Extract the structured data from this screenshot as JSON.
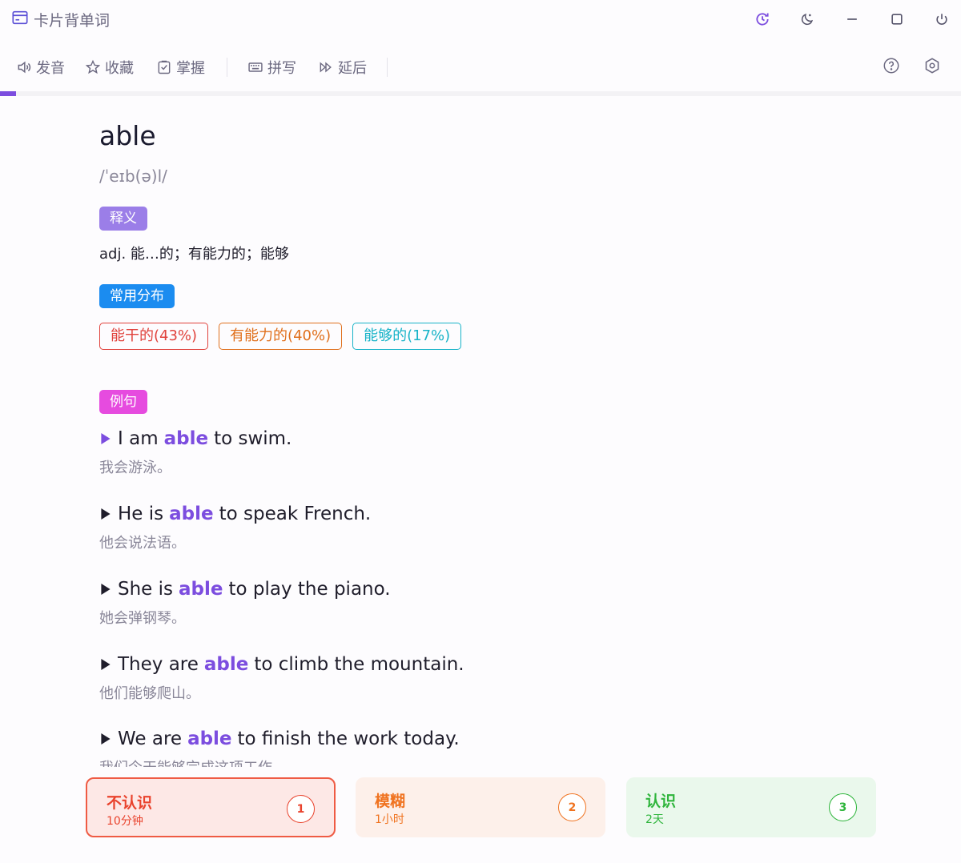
{
  "app": {
    "title": "卡片背单词",
    "icon": "card-icon"
  },
  "window_controls": [
    {
      "name": "history-icon",
      "color": "#7c4ddf"
    },
    {
      "name": "moon-icon"
    },
    {
      "name": "minimize-icon"
    },
    {
      "name": "maximize-icon"
    },
    {
      "name": "power-icon"
    }
  ],
  "toolbar": {
    "pronounce_label": "发音",
    "favorite_label": "收藏",
    "master_label": "掌握",
    "spell_label": "拼写",
    "postpone_label": "延后"
  },
  "progress": {
    "fraction": 0.017,
    "color": "#7c4ddf"
  },
  "card": {
    "word": "able",
    "phonetic": "/ˈeɪb(ə)l/",
    "definition_label": "释义",
    "definition": "adj. 能…的；有能力的；能够",
    "frequency_label": "常用分布",
    "frequency_tags": [
      "能干的(43%)",
      "有能力的(40%)",
      "能够的(17%)"
    ],
    "examples_label": "例句",
    "examples": [
      {
        "pre": "I am",
        "word": "able",
        "post": "to swim.",
        "zh": "我会游泳。"
      },
      {
        "pre": "He is",
        "word": "able",
        "post": "to speak French.",
        "zh": "他会说法语。"
      },
      {
        "pre": "She is",
        "word": "able",
        "post": "to play the piano.",
        "zh": "她会弹钢琴。"
      },
      {
        "pre": "They are",
        "word": "able",
        "post": "to climb the mountain.",
        "zh": "他们能够爬山。"
      },
      {
        "pre": "We are",
        "word": "able",
        "post": "to finish the work today.",
        "zh": "我们今天能够完成这项工作。"
      }
    ]
  },
  "answers": {
    "unknown": {
      "title": "不认识",
      "sub": "10分钟",
      "key": "1",
      "color": "#e9432d"
    },
    "vague": {
      "title": "模糊",
      "sub": "1小时",
      "key": "2",
      "color": "#f07320"
    },
    "known": {
      "title": "认识",
      "sub": "2天",
      "key": "3",
      "color": "#2fb53c"
    }
  }
}
